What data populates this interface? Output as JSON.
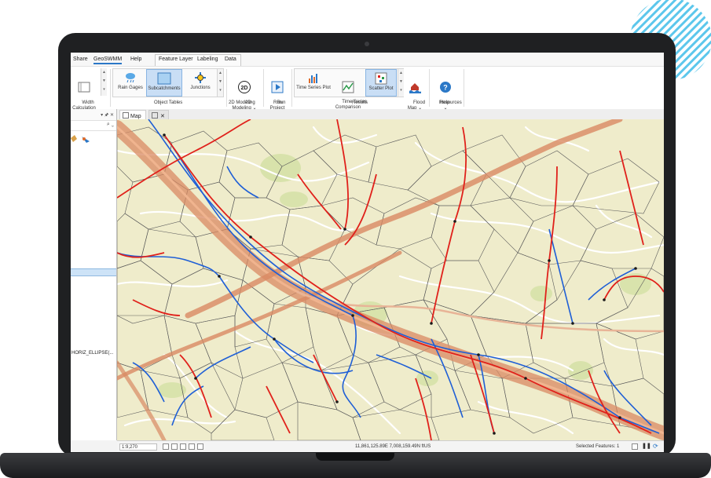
{
  "menubar": {
    "tabs": [
      "Share",
      "GeoSWMM",
      "Help",
      "Feature Layer",
      "Labeling",
      "Data"
    ],
    "active_tab": "GeoSWMM"
  },
  "ribbon": {
    "width_calc": "Width\nCalculation",
    "object_tables": {
      "label": "Object Tables",
      "items": [
        "Rain Gages",
        "Subcatchments",
        "Junctions"
      ],
      "selected": "Subcatchments"
    },
    "modeling_2d": {
      "icon_text": "2D",
      "button": "2D\nModeling ⌄",
      "label": "2D Modeling"
    },
    "run": {
      "button": "Run\nProject",
      "label": "Run"
    },
    "results": {
      "label": "Results",
      "items": [
        "Time Series Plot",
        "Time Series\nComparison",
        "Scatter Plot"
      ],
      "selected": "Scatter Plot",
      "flood_map": "Flood\nMap ⌄"
    },
    "help": {
      "button": "Resources\n⌄",
      "label": "Help"
    }
  },
  "left_pane": {
    "header_glyphs": "▾ 🖈 ✕",
    "search_glyphs": "⌕ ⌄",
    "layer_text": "HORIZ_ELLIPSE(..."
  },
  "map_tab": {
    "label": "Map",
    "close": "✕"
  },
  "statusbar": {
    "scale": "1:9,270",
    "coordinates": "11,861,125.89E 7,008,159.49N ftUS",
    "selected_features": "Selected Features: 1"
  },
  "colors": {
    "map_background": "#efeccb",
    "road_major": "#d98a63",
    "conduit_blue": "#1f5fd6",
    "conduit_red": "#e0211b",
    "subcatchment_outline": "#5a5a5a",
    "selection_blue": "#c9def5",
    "deco_stripes": "#5cc7ec"
  },
  "icons": [
    "width-calc-icon",
    "rain-gage-icon",
    "subcatchment-icon",
    "junction-icon",
    "2d-modeling-icon",
    "run-icon",
    "time-series-icon",
    "ts-comparison-icon",
    "scatter-plot-icon",
    "flood-map-icon",
    "resources-icon",
    "search-icon",
    "map-icon",
    "pause-icon",
    "refresh-icon"
  ]
}
